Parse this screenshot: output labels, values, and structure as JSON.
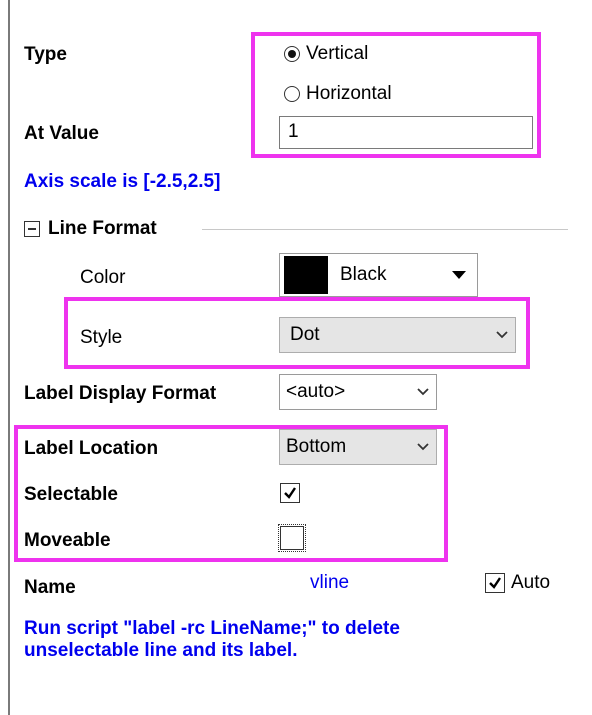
{
  "type": {
    "label": "Type",
    "options": [
      "Vertical",
      "Horizontal"
    ],
    "selected": "Vertical"
  },
  "at_value": {
    "label": "At Value",
    "value": "1"
  },
  "axis_scale": "Axis scale is [-2.5,2.5]",
  "line_format": {
    "header": "Line Format",
    "color": {
      "label": "Color",
      "value": "Black",
      "swatch": "#000000"
    },
    "style": {
      "label": "Style",
      "value": "Dot"
    }
  },
  "label_display_format": {
    "label": "Label Display Format",
    "value": "<auto>"
  },
  "label_location": {
    "label": "Label Location",
    "value": "Bottom"
  },
  "selectable": {
    "label": "Selectable",
    "checked": true
  },
  "moveable": {
    "label": "Moveable",
    "checked": false
  },
  "name": {
    "label": "Name",
    "value": "vline",
    "auto_label": "Auto",
    "auto_checked": true
  },
  "hint": "Run script \"label -rc LineName;\" to delete unselectable line and its label.",
  "colors": {
    "highlight": "#ee33ee",
    "link_blue": "#0000ee"
  }
}
